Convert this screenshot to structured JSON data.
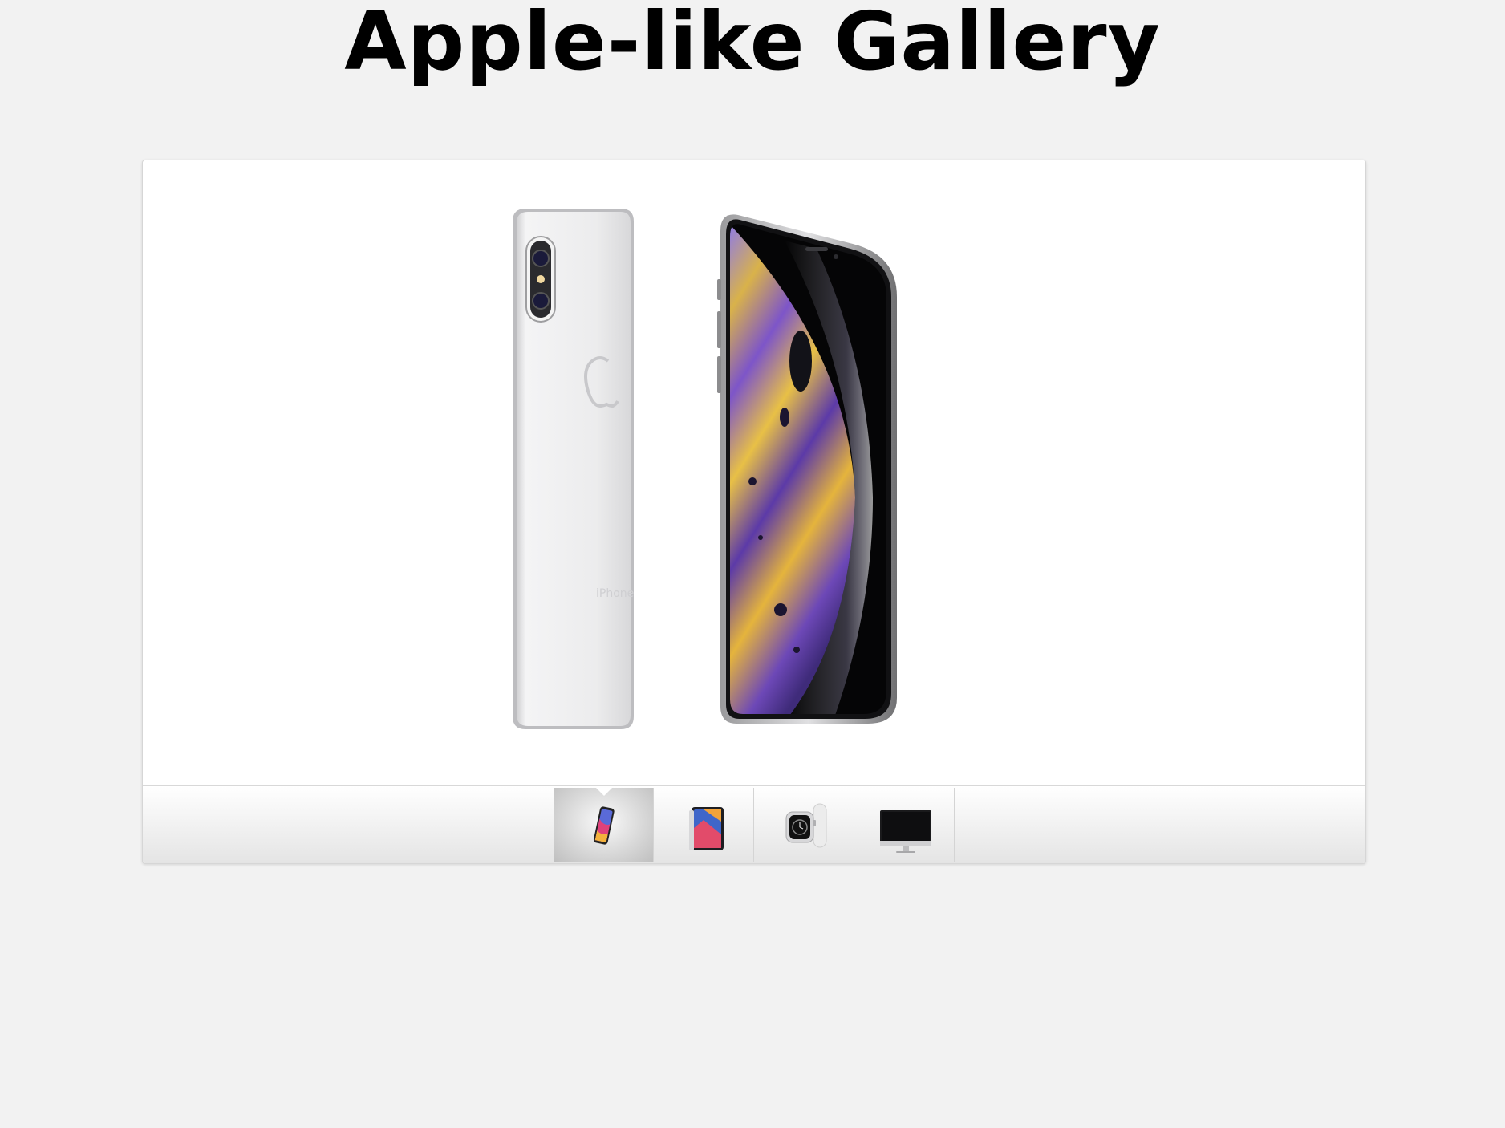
{
  "page": {
    "title": "Apple-like Gallery"
  },
  "gallery": {
    "main_image": "iphone-xs-product-image",
    "thumbnails": [
      {
        "name": "iphone-thumbnail",
        "icon": "iphone-icon",
        "active": true
      },
      {
        "name": "ipad-thumbnail",
        "icon": "ipad-icon",
        "active": false
      },
      {
        "name": "apple-watch-thumbnail",
        "icon": "watch-icon",
        "active": false
      },
      {
        "name": "imac-thumbnail",
        "icon": "imac-icon",
        "active": false
      }
    ]
  },
  "colors": {
    "background": "#f2f2f2",
    "panel": "#ffffff",
    "phone_silver": "#e9e9ea",
    "screen_purple": "#7b5bd6",
    "screen_gold": "#e6b43a"
  }
}
